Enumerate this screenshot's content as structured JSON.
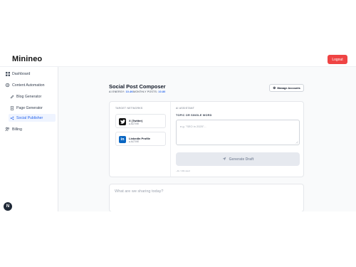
{
  "header": {
    "brand": "Minineo",
    "logout_label": "Logout"
  },
  "sidebar": {
    "items": [
      {
        "label": "Dashboard",
        "icon": "grid-icon"
      },
      {
        "label": "Content Automation",
        "icon": "sparkle-icon"
      },
      {
        "label": "Blog Generator",
        "icon": "pen-icon"
      },
      {
        "label": "Page Generator",
        "icon": "document-icon"
      },
      {
        "label": "Social Publisher",
        "icon": "share-icon",
        "active": true
      },
      {
        "label": "Billing",
        "icon": "people-icon"
      }
    ],
    "avatar_letter": "N"
  },
  "page": {
    "title": "Social Post Composer",
    "energy_label": "AI ENERGY:",
    "energy_value": "10.4K",
    "posts_label": "MONTHLY POSTS:",
    "posts_value": "10.80",
    "manage_label": "Manage Accounts"
  },
  "composer": {
    "targets_label": "TARGET NETWORKS",
    "networks": [
      {
        "name": "X (Twitter)",
        "status": "● ACTIVE",
        "icon": "twitter-icon",
        "color": "#111111"
      },
      {
        "name": "LinkedIn Profile",
        "status": "● ACTIVE",
        "icon": "linkedin-icon",
        "color": "#0a66c2"
      }
    ],
    "assistant_label": "AI ASSISTANT",
    "topic_label": "TOPIC OR SINGLE WORD",
    "topic_placeholder": "e.g. \"SEO in 2025\"...",
    "generate_label": "Generate Draft",
    "credits_note": "~1k / 10k used"
  },
  "post": {
    "placeholder": "What are we sharing today?"
  },
  "colors": {
    "accent": "#2563eb",
    "danger": "#ef4444"
  }
}
